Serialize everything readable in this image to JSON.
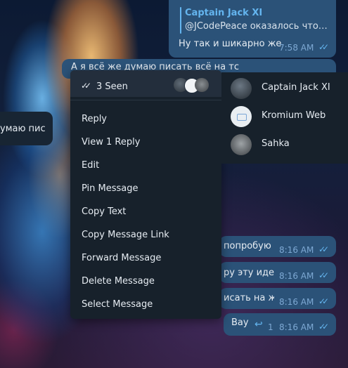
{
  "chat": {
    "top_message": {
      "reply_author": "Captain Jack XI",
      "reply_snippet": "@JCodePeace оказалось что де...",
      "text": "Ну так и шикарно же",
      "time": "7:58 AM"
    },
    "selected_message": {
      "text": "А я всё же думаю писать всё на тс"
    },
    "incoming_message": {
      "text": "умаю пис..."
    },
    "lower_messages": [
      {
        "text": "попробую",
        "time": "8:16 AM"
      },
      {
        "text": "ру эту идею",
        "time": "8:16 AM"
      },
      {
        "text": "исать на жс",
        "time": "8:16 AM"
      },
      {
        "text": "Вау",
        "reply_count": "1",
        "time": "8:16 AM"
      }
    ]
  },
  "context_menu": {
    "seen_label": "3 Seen",
    "items": [
      "Reply",
      "View 1 Reply",
      "Edit",
      "Pin Message",
      "Copy Text",
      "Copy Message Link",
      "Forward Message",
      "Delete Message",
      "Select Message"
    ]
  },
  "seen_by": [
    {
      "name": "Captain Jack XI",
      "avatar_color": "#3a4552"
    },
    {
      "name": "Kromium Web",
      "avatar_color": "#e9eef2"
    },
    {
      "name": "Sahka",
      "avatar_color": "#5a5f63"
    }
  ],
  "colors": {
    "outgoing_bubble": "#2b5278",
    "menu_background": "#17212b",
    "accent": "#64b5ef"
  }
}
